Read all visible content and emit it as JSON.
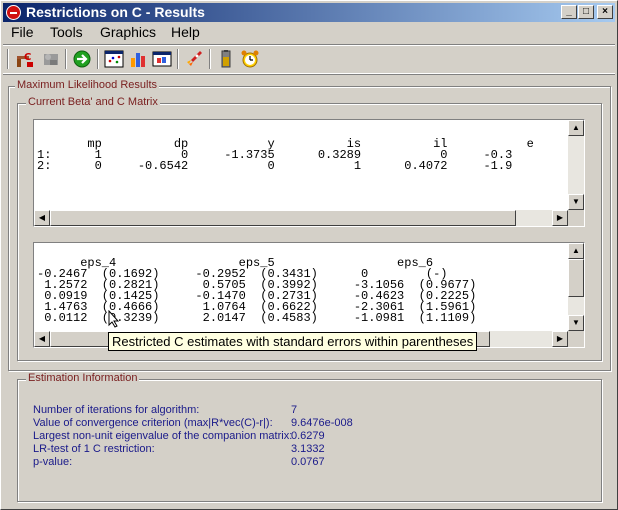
{
  "window": {
    "title": "Restrictions on C - Results",
    "controls": {
      "minimize": "_",
      "maximize": "□",
      "close": "×"
    }
  },
  "menu": [
    "File",
    "Tools",
    "Graphics",
    "Help"
  ],
  "toolbar_icons": [
    "restrictions-icon",
    "disabled-tool-icon",
    "go-arrow-icon",
    "scatter-plot-icon",
    "bar-chart-icon",
    "graph-window-icon",
    "rocket-icon",
    "battery-icon",
    "alarm-clock-icon"
  ],
  "groups": {
    "ml": "Maximum Likelihood Results",
    "matrix": "Current Beta' and C Matrix",
    "estimation": "Estimation Information"
  },
  "beta_pane": {
    "header": "       mp          dp           y          is          il           e",
    "rows": [
      "1:      1           0     -1.3735      0.3289           0     -0.3",
      "2:      0     -0.6542           0           1      0.4072     -1.9"
    ]
  },
  "c_pane": {
    "header": "      eps_4                 eps_5                 eps_6",
    "rows": [
      "-0.2467  (0.1692)     -0.2952  (0.3431)      0        (-)",
      " 1.2572  (0.2821)      0.5705  (0.3992)     -3.1056  (0.9677)",
      " 0.0919  (0.1425)     -0.1470  (0.2731)     -0.4623  (0.2225)",
      " 1.4763  (0.4666)      1.0764  (0.6622)     -2.3061  (1.5961)",
      " 0.0112  (0.3239)      2.0147  (0.4583)     -1.0981  (1.1109)"
    ]
  },
  "tooltip": "Restricted C estimates with standard errors within parentheses",
  "estimation": [
    {
      "label": "Number of iterations for algorithm:",
      "value": "7"
    },
    {
      "label": "Value of convergence criterion (max|R*vec(C)-r|):",
      "value": "9.6476e-008"
    },
    {
      "label": "Largest non-unit eigenvalue of the companion matrix:",
      "value": "0.6279"
    },
    {
      "label": "LR-test of 1 C restriction:",
      "value": "3.1332"
    },
    {
      "label": "p-value:",
      "value": "0.0767"
    }
  ]
}
